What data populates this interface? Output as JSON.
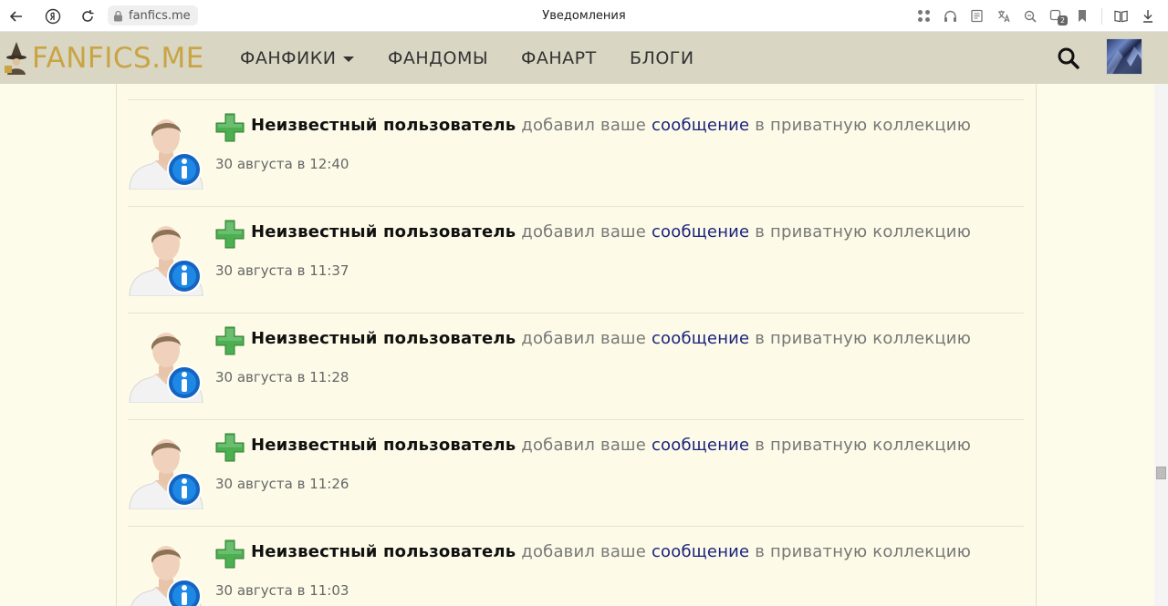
{
  "browser": {
    "url": "fanfics.me",
    "title": "Уведомления",
    "badge_count": "2"
  },
  "site": {
    "logo_text": "FANFICS.ME",
    "nav": [
      "ФАНФИКИ",
      "ФАНДОМЫ",
      "ФАНАРТ",
      "БЛОГИ"
    ]
  },
  "notifications": [
    {
      "user": "Неизвестный пользователь",
      "action1": "добавил ваше",
      "link": "сообщение",
      "action2": "в приватную коллекцию",
      "date": "30 августа в 12:40"
    },
    {
      "user": "Неизвестный пользователь",
      "action1": "добавил ваше",
      "link": "сообщение",
      "action2": "в приватную коллекцию",
      "date": "30 августа в 11:37"
    },
    {
      "user": "Неизвестный пользователь",
      "action1": "добавил ваше",
      "link": "сообщение",
      "action2": "в приватную коллекцию",
      "date": "30 августа в 11:28"
    },
    {
      "user": "Неизвестный пользователь",
      "action1": "добавил ваше",
      "link": "сообщение",
      "action2": "в приватную коллекцию",
      "date": "30 августа в 11:26"
    },
    {
      "user": "Неизвестный пользователь",
      "action1": "добавил ваше",
      "link": "сообщение",
      "action2": "в приватную коллекцию",
      "date": "30 августа в 11:03"
    }
  ],
  "colors": {
    "navbar": "#d9d6c3",
    "logo": "#c9a445",
    "content_bg": "#fdfbe8",
    "link": "#1a237e",
    "plus_green": "#4caf50"
  }
}
